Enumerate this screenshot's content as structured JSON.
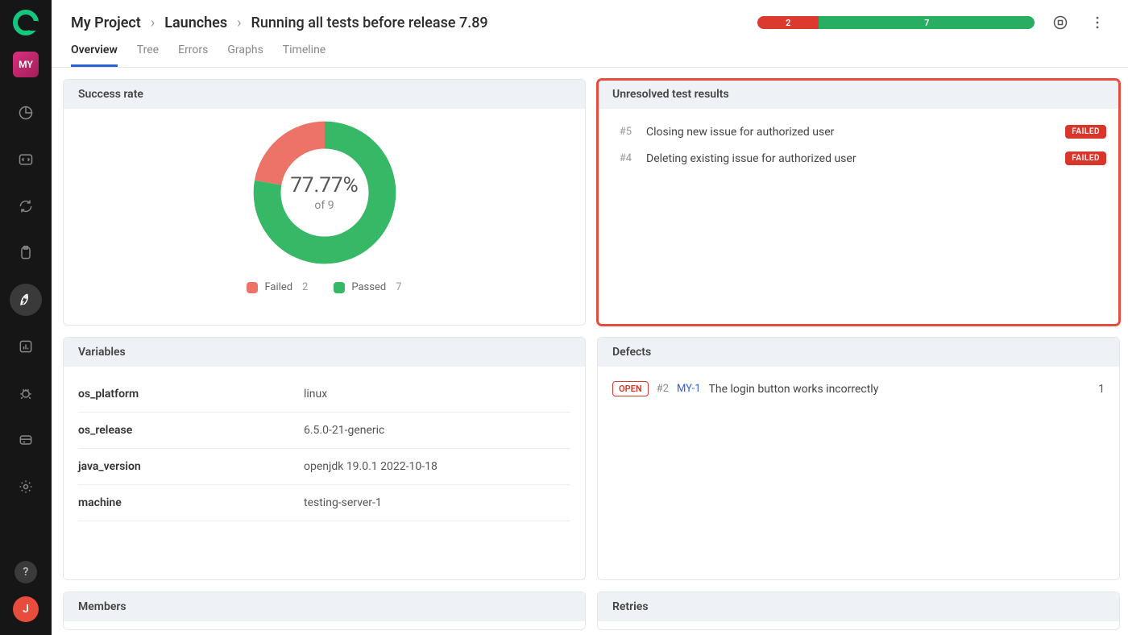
{
  "sidebar": {
    "project_badge": "MY",
    "user_initial": "J",
    "help_label": "?"
  },
  "breadcrumb": {
    "project": "My Project",
    "section": "Launches",
    "title": "Running all tests before release 7.89"
  },
  "status_bar": {
    "failed": 2,
    "passed": 7
  },
  "tabs": [
    "Overview",
    "Tree",
    "Errors",
    "Graphs",
    "Timeline"
  ],
  "active_tab": "Overview",
  "cards": {
    "success_rate": {
      "title": "Success rate",
      "percent_label": "77.77%",
      "of_label": "of 9",
      "legend_failed": "Failed",
      "legend_failed_n": "2",
      "legend_passed": "Passed",
      "legend_passed_n": "7"
    },
    "unresolved": {
      "title": "Unresolved test results",
      "items": [
        {
          "num": "#5",
          "name": "Closing new issue for authorized user",
          "badge": "FAILED"
        },
        {
          "num": "#4",
          "name": "Deleting existing issue for authorized user",
          "badge": "FAILED"
        }
      ]
    },
    "variables": {
      "title": "Variables",
      "rows": [
        {
          "key": "os_platform",
          "val": "linux"
        },
        {
          "key": "os_release",
          "val": "6.5.0-21-generic"
        },
        {
          "key": "java_version",
          "val": "openjdk 19.0.1 2022-10-18"
        },
        {
          "key": "machine",
          "val": "testing-server-1"
        }
      ]
    },
    "defects": {
      "title": "Defects",
      "items": [
        {
          "status": "OPEN",
          "num": "#2",
          "code": "MY-1",
          "title": "The login button works incorrectly",
          "count": "1"
        }
      ]
    },
    "members": {
      "title": "Members"
    },
    "retries": {
      "title": "Retries"
    }
  },
  "colors": {
    "green": "#36b866",
    "red": "#ed7368",
    "fail_bar": "#dc3a2f",
    "pass_bar": "#27ae60"
  },
  "chart_data": {
    "type": "pie",
    "title": "Success rate",
    "series": [
      {
        "name": "Failed",
        "value": 2,
        "color": "#ed7368"
      },
      {
        "name": "Passed",
        "value": 7,
        "color": "#36b866"
      }
    ],
    "total": 9,
    "percent": 77.77
  }
}
